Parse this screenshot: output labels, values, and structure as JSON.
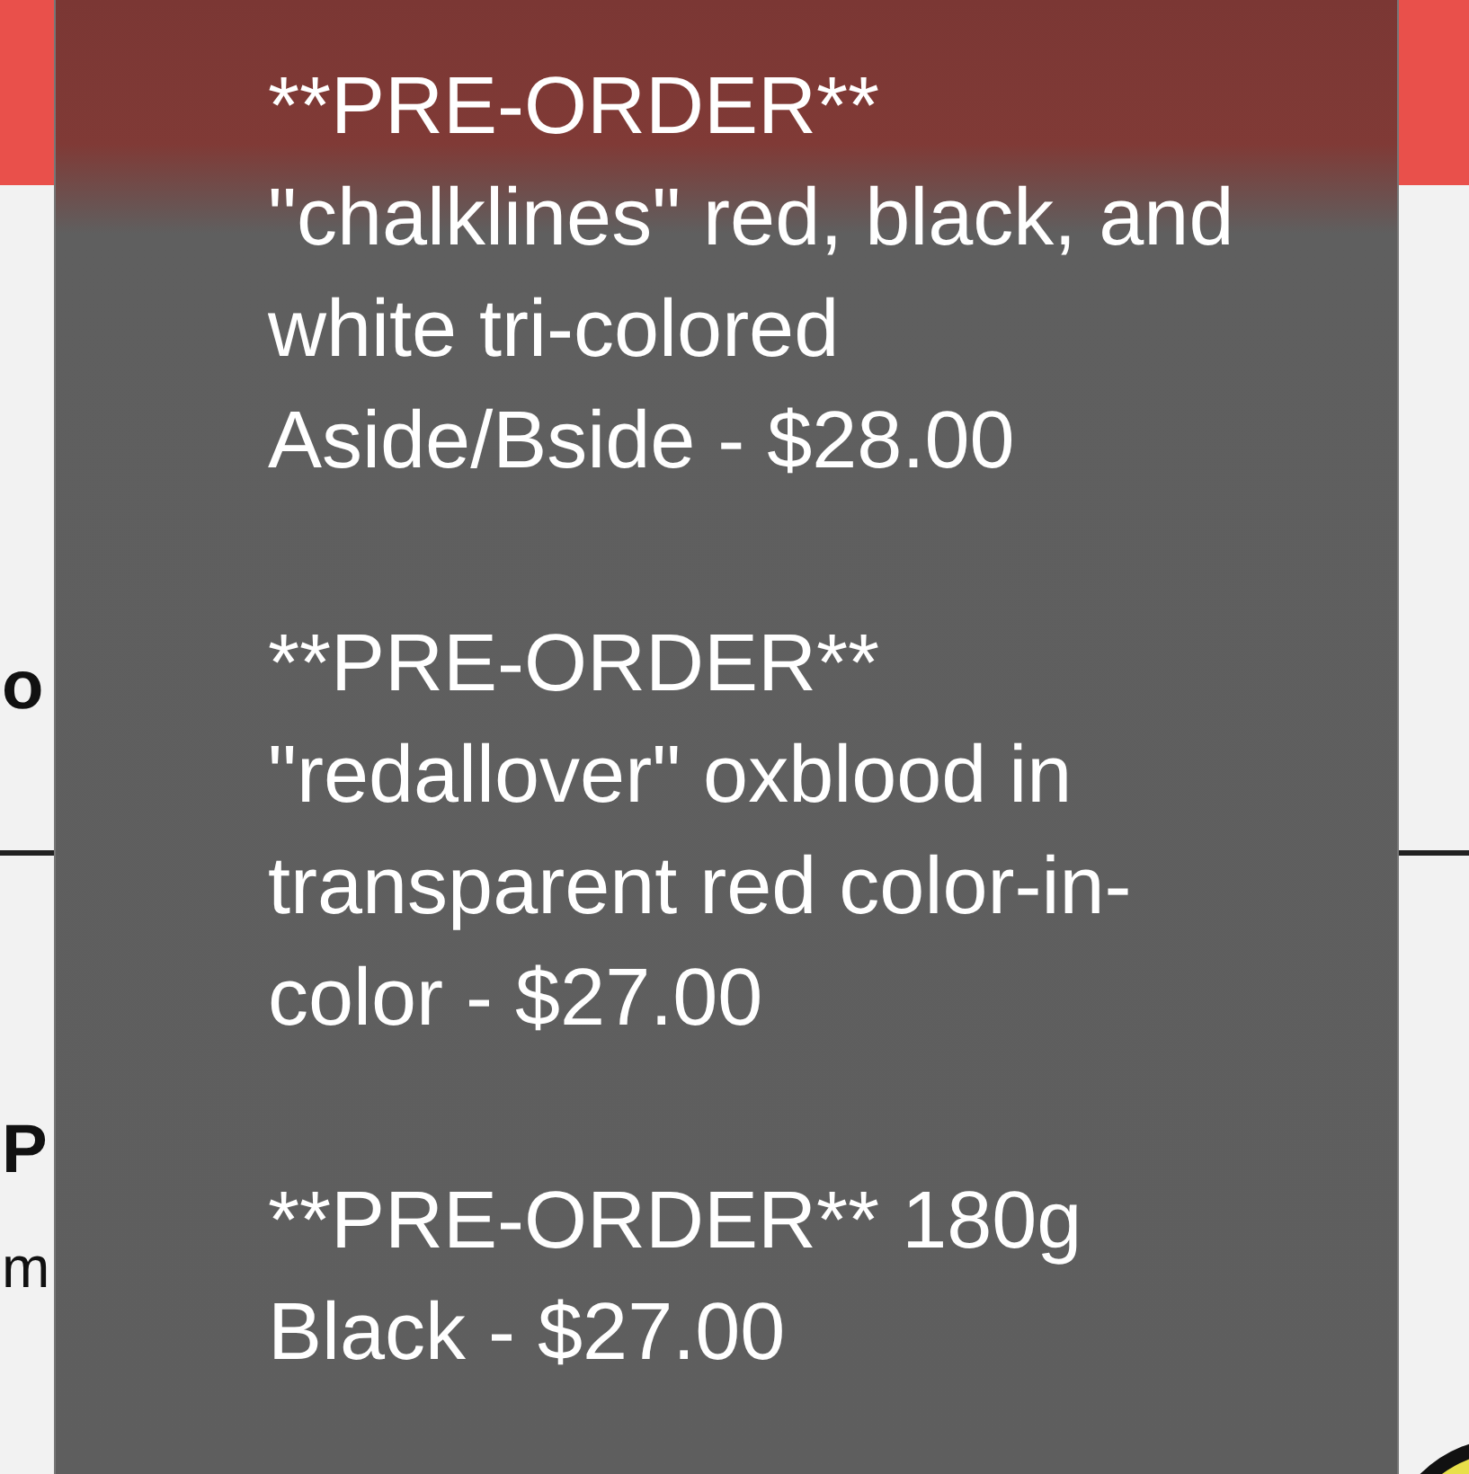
{
  "page": {
    "fragments": [
      {
        "text": "o",
        "kind": "title"
      },
      {
        "text": "P",
        "kind": "title"
      },
      {
        "text": "m",
        "kind": "body"
      }
    ]
  },
  "picker": {
    "options": [
      {
        "label": "**PRE-ORDER** \"chalklines\" red, black, and white tri-colored Aside/Bside - $28.00"
      },
      {
        "label": "**PRE-ORDER** \"redallover\" oxblood in transparent red color-in-color - $27.00"
      },
      {
        "label": "**PRE-ORDER** 180g Black - $27.00"
      }
    ]
  }
}
